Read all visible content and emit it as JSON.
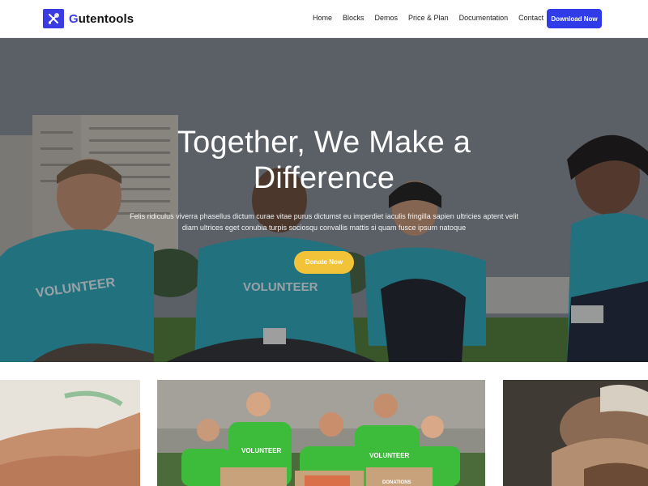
{
  "header": {
    "logo": {
      "text_initial": "G",
      "text_rest": "utentools",
      "icon": "tools-icon"
    },
    "nav": [
      {
        "label": "Home"
      },
      {
        "label": "Blocks"
      },
      {
        "label": "Demos"
      },
      {
        "label": "Price & Plan"
      },
      {
        "label": "Documentation"
      },
      {
        "label": "Contact"
      }
    ],
    "cta_label": "Download Now"
  },
  "hero": {
    "title": "Together, We Make a Difference",
    "text": "Felis ridiculus viverra phasellus dictum curae vitae purus dictumst eu imperdiet iaculis fringilla sapien ultricies aptent velit diam ultrices eget conubia turpis sociosqu convallis mattis si quam fusce ipsum natoque",
    "button_label": "Donate Now",
    "shirt_text": "VOLUNTEER"
  },
  "cards": {
    "shirt_text": "VOLUNTEER",
    "box_text": "DONATIONS"
  },
  "colors": {
    "brand": "#3b3be3",
    "cta": "#2f3ce8",
    "donate": "#f2c238",
    "shirt": "#2aa6b8",
    "green_shirt": "#3dbb3a"
  }
}
